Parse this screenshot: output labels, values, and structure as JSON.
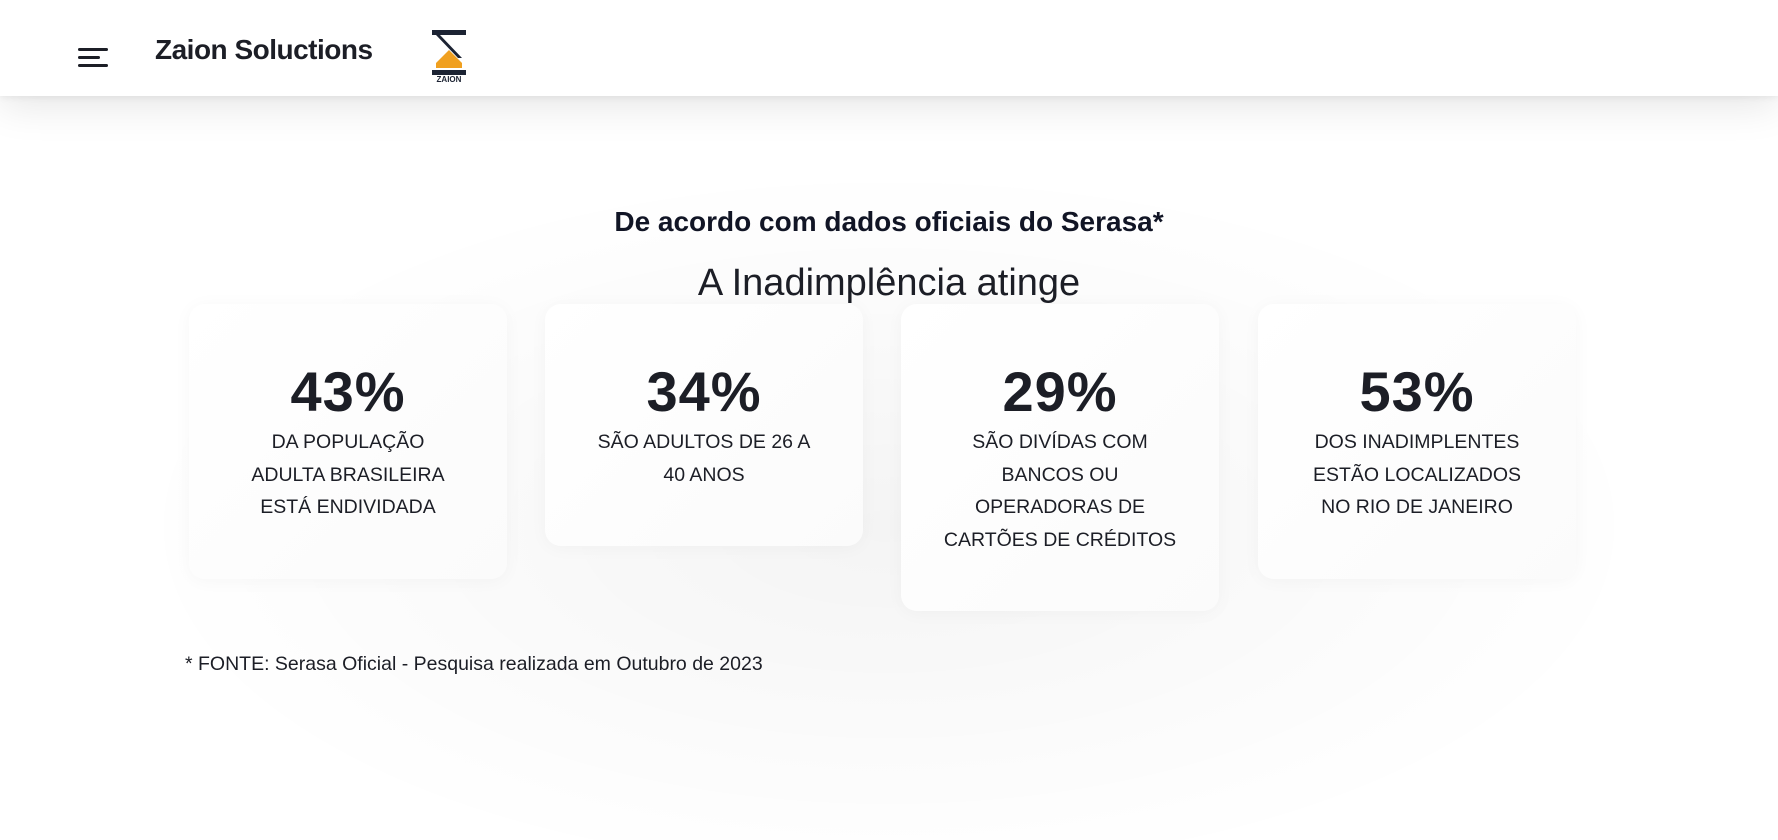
{
  "navbar": {
    "brand": "Zaion Soluctions",
    "menu_icon": "hamburger-menu-icon",
    "logo_text": "ZAION",
    "logo_colors": {
      "dark": "#1c2333",
      "accent": "#f0a020"
    }
  },
  "section": {
    "subtitle": "De acordo com dados oficiais do Serasa*",
    "heading": "A Inadimplência atinge",
    "stats": [
      {
        "percent": "43%",
        "line1": "DA POPULAÇÃO",
        "line2": "ADULTA BRASILEIRA",
        "line3": "ESTÁ ENDIVIDADA",
        "line4": ""
      },
      {
        "percent": "34%",
        "line1": "SÃO ADULTOS DE 26 A",
        "line2": "40 ANOS",
        "line3": "",
        "line4": ""
      },
      {
        "percent": "29%",
        "line1": "SÃO DIVÍDAS COM",
        "line2": "BANCOS OU",
        "line3": "OPERADORAS DE",
        "line4": "CARTÕES DE CRÉDITOS"
      },
      {
        "percent": "53%",
        "line1": "DOS INADIMPLENTES",
        "line2": "ESTÃO LOCALIZADOS",
        "line3": "NO RIO DE JANEIRO",
        "line4": ""
      }
    ],
    "source": "* FONTE: Serasa Oficial - Pesquisa realizada em Outubro de 2023"
  }
}
